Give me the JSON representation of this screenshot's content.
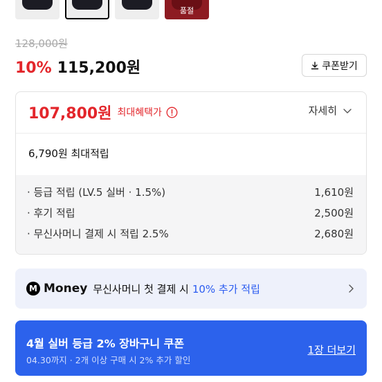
{
  "thumbnails": {
    "colors": [
      "#1c1c24",
      "#1c1c24",
      "#1c1c24",
      "#8d1b22"
    ],
    "soldout_label": "품절"
  },
  "pricing": {
    "original_price": "128,000원",
    "discount_rate": "10%",
    "sale_price": "115,200원",
    "coupon_button_label": "쿠폰받기"
  },
  "benefit": {
    "max_benefit_price": "107,800원",
    "max_benefit_label": "최대혜택가",
    "detail_label": "자세히",
    "max_points": "6,790원 최대적립",
    "rows": [
      {
        "label": "· 등급 적립 (LV.5 실버 · 1.5%)",
        "value": "1,610원"
      },
      {
        "label": "· 후기 적립",
        "value": "2,500원"
      },
      {
        "label": "· 무신사머니 결제 시 적립 2.5%",
        "value": "2,680원"
      }
    ]
  },
  "money_banner": {
    "logo_letter": "M",
    "brand": "Money",
    "text": "무신사머니 첫 결제 시",
    "highlight": "10% 추가 적립",
    "accent_color": "#2b5cf0"
  },
  "coupon_banner": {
    "title": "4월 실버 등급 2% 장바구니 쿠폰",
    "subtitle": "04.30까지 · 2개 이상 구매 시 2% 추가 할인",
    "link": "1장 더보기",
    "background": "#2c62ec"
  },
  "colors": {
    "discount_red": "#e3262b"
  }
}
